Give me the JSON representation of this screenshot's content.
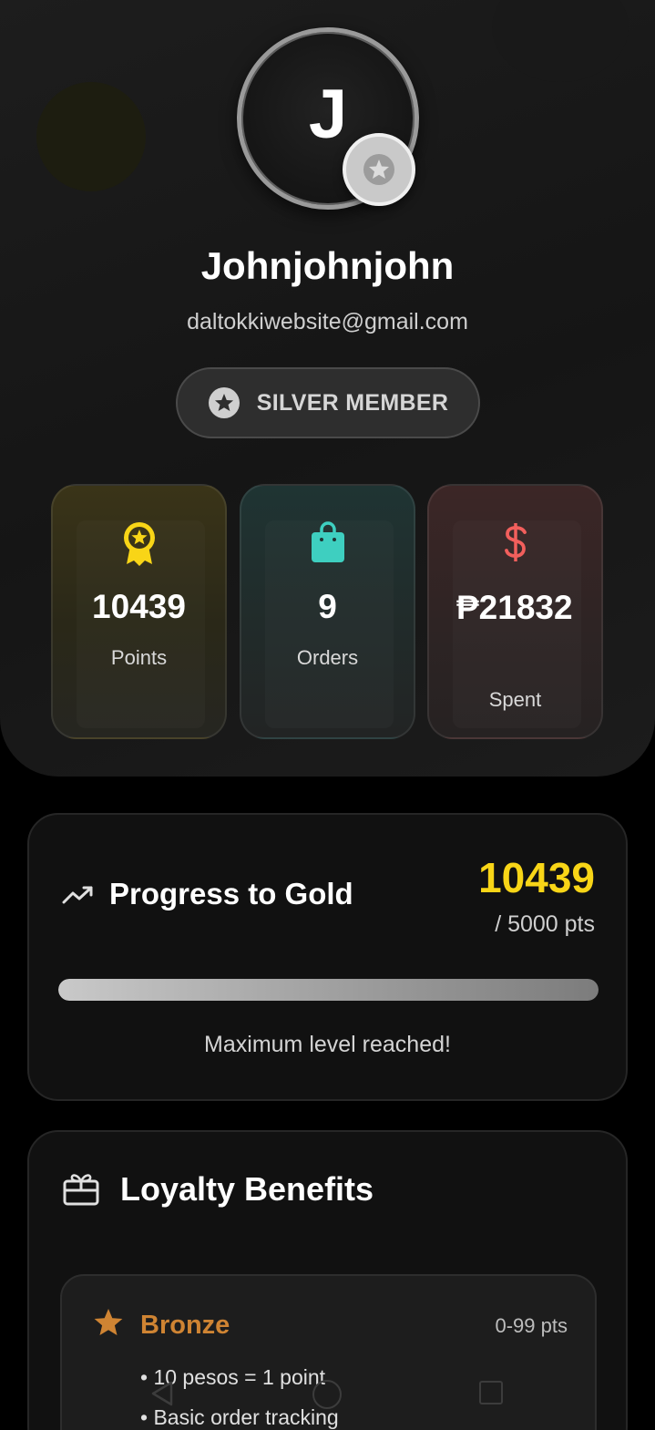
{
  "profile": {
    "initial": "J",
    "name": "Johnjohnjohn",
    "email": "daltokkiwebsite@gmail.com",
    "tier_label": "SILVER MEMBER"
  },
  "stats": {
    "points": {
      "value": "10439",
      "label": "Points",
      "icon": "award-icon",
      "color": "#f8d517"
    },
    "orders": {
      "value": "9",
      "label": "Orders",
      "icon": "shopping-bag-icon",
      "color": "#3ecfc0"
    },
    "spent": {
      "value": "₱21832",
      "label": "Spent",
      "icon": "dollar-icon",
      "color": "#f25f5c"
    }
  },
  "progress": {
    "title": "Progress to Gold",
    "points": "10439",
    "goal": "/ 5000 pts",
    "fill_percent": 100,
    "note": "Maximum level reached!"
  },
  "benefits": {
    "title": "Loyalty Benefits",
    "tiers": [
      {
        "name": "Bronze",
        "range": "0-99 pts",
        "color": "#cf8433",
        "items": [
          "• 10 pesos = 1 point",
          "• Basic order tracking"
        ]
      }
    ]
  },
  "colors": {
    "accent_gold": "#f8d517",
    "bronze": "#cf8433",
    "background": "#000000"
  }
}
